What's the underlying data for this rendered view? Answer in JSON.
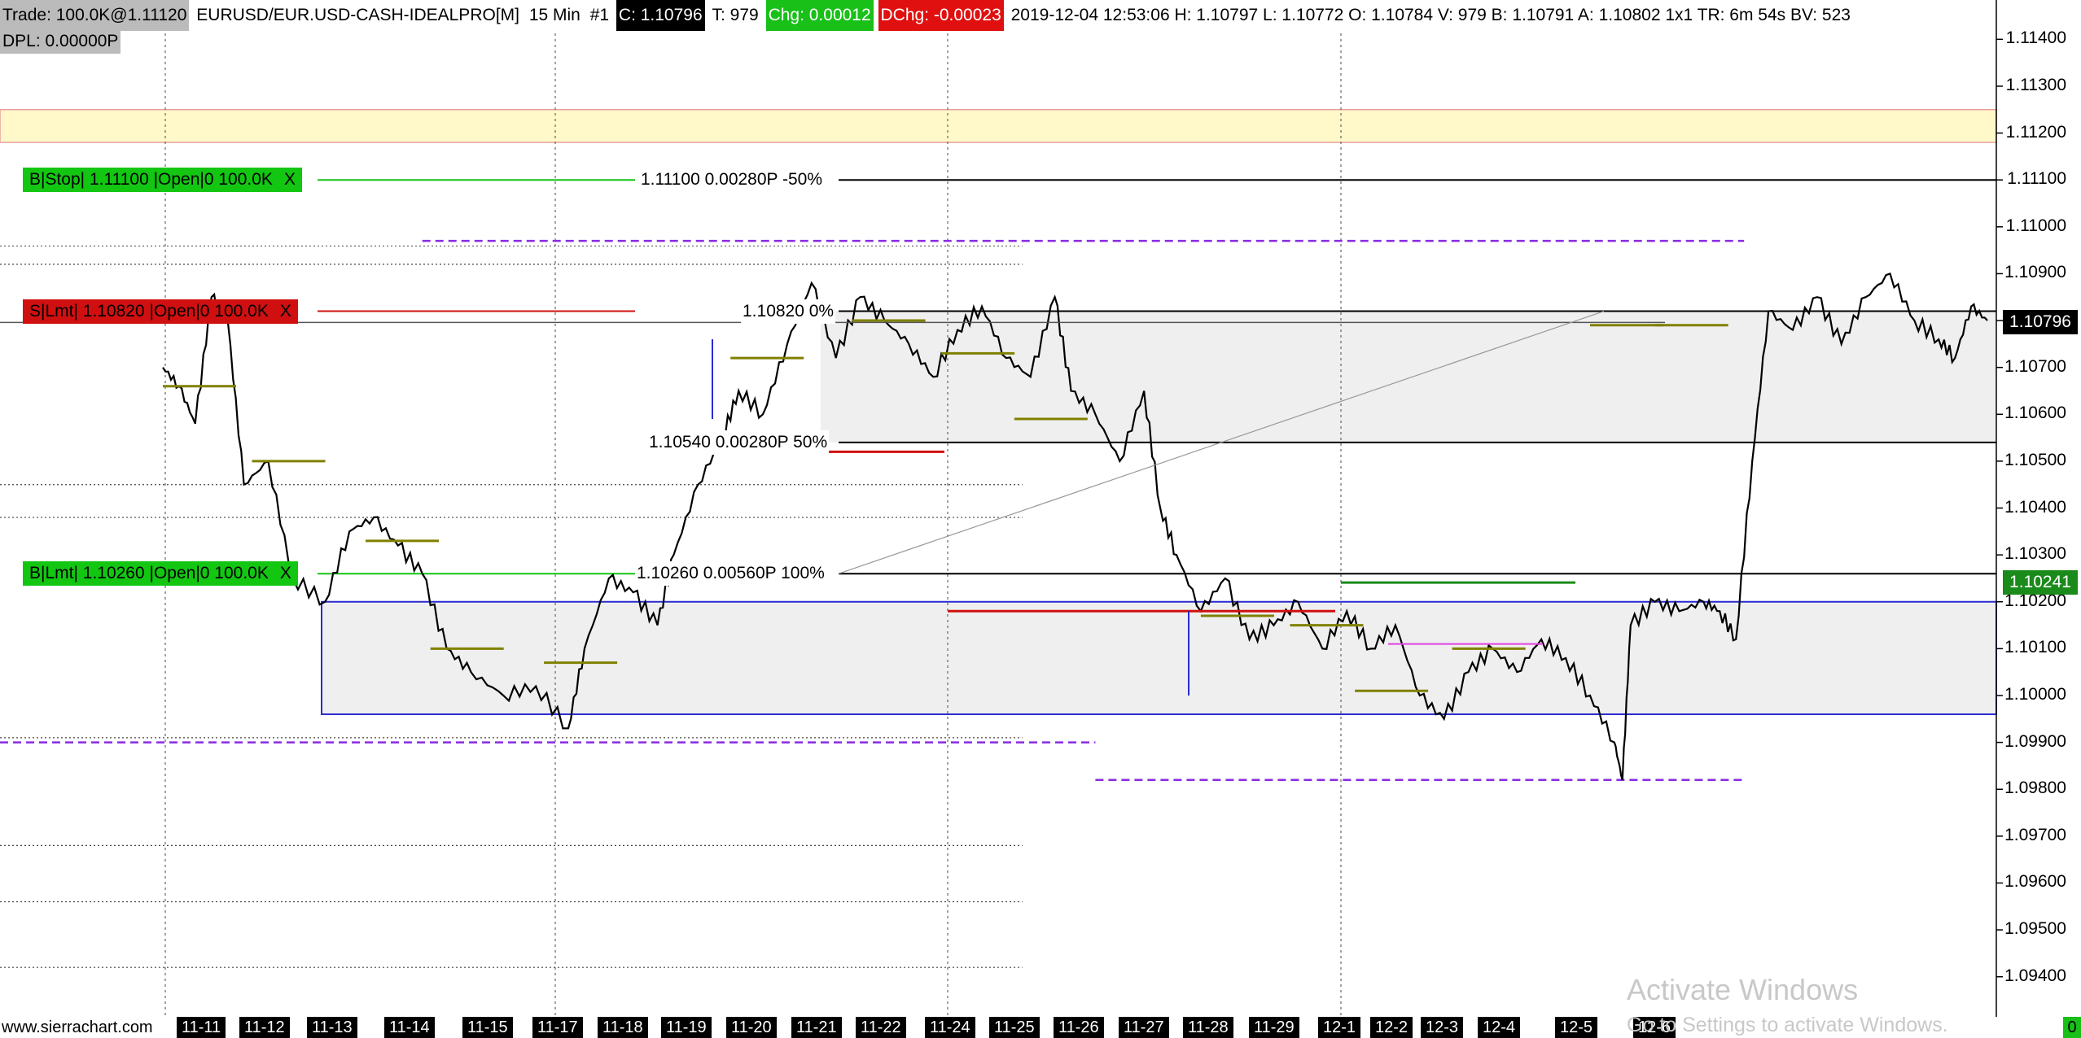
{
  "header": {
    "trade": "Trade: 100.0K@1.11120",
    "symbol": "EURUSD/EUR.USD-CASH-IDEALPRO[M]",
    "interval": "15 Min",
    "chart_num": "#1",
    "close": "C: 1.10796",
    "ticks": "T: 979",
    "chg": "Chg: 0.00012",
    "dchg": "DChg: -0.00023",
    "stats": "2019-12-04 12:53:06 H: 1.10797 L: 1.10772 O: 1.10784 V: 979 B: 1.10791 A: 1.10802 1x1 TR: 6m 54s BV: 523",
    "dpl": "DPL: 0.00000P"
  },
  "orders": [
    {
      "text": "B|Stop| 1.11100 |Open|0  100.0K",
      "close": "X",
      "color": "#12c612",
      "price": 1.111
    },
    {
      "text": "S|Lmt| 1.10820 |Open|0  100.0K",
      "close": "X",
      "color": "#d01010",
      "price": 1.1082
    },
    {
      "text": "B|Lmt| 1.10260 |Open|0  100.0K",
      "close": "X",
      "color": "#12c612",
      "price": 1.1026
    }
  ],
  "fib_labels": [
    {
      "text": "1.11100 0.00280P -50%",
      "price": 1.111
    },
    {
      "text": "1.10820 0%",
      "price": 1.1082
    },
    {
      "text": "1.10540 0.00280P 50%",
      "price": 1.1054
    },
    {
      "text": "1.10260 0.00560P 100%",
      "price": 1.1026
    }
  ],
  "price_tags": [
    {
      "text": "1.10796",
      "price": 1.10796,
      "bg": "#000000"
    },
    {
      "text": "1.10241",
      "price": 1.10241,
      "bg": "#1a8a1a"
    }
  ],
  "footer": {
    "website": "www.sierrachart.com",
    "activate_title": "Activate Windows",
    "activate_sub": "Go to Settings to activate Windows.",
    "corner_badge": "0"
  },
  "colors": {
    "zone_yellow": "#fff8c8",
    "zone_gray": "#efefef",
    "dashed_purple": "#8a2be2",
    "up_line": "#12c612",
    "down_line": "#d01010"
  },
  "chart_data": {
    "type": "candlestick",
    "title": "",
    "xlabel": "",
    "ylabel": "",
    "ylim": [
      1.0937,
      1.1147
    ],
    "yticks": [
      "1.11400",
      "1.11300",
      "1.11200",
      "1.11100",
      "1.11000",
      "1.10900",
      "1.10800",
      "1.10700",
      "1.10600",
      "1.10500",
      "1.10400",
      "1.10300",
      "1.10200",
      "1.10100",
      "1.10000",
      "1.09900",
      "1.09800",
      "1.09700",
      "1.09600",
      "1.09500",
      "1.09400"
    ],
    "xticks": [
      "11-11",
      "11-12",
      "11-13",
      "11-14",
      "11-15",
      "11-17",
      "11-18",
      "11-19",
      "11-20",
      "11-21",
      "11-22",
      "11-24",
      "11-25",
      "11-26",
      "11-27",
      "11-28",
      "11-29",
      "12-1",
      "12-2",
      "12-3",
      "12-4",
      "12-5",
      "12-6"
    ],
    "price_path": [
      [
        0,
        1.107
      ],
      [
        0.2,
        1.1066
      ],
      [
        0.4,
        1.1058
      ],
      [
        0.6,
        1.1085
      ],
      [
        0.8,
        1.108
      ],
      [
        1.0,
        1.1045
      ],
      [
        1.3,
        1.105
      ],
      [
        1.6,
        1.1025
      ],
      [
        2.0,
        1.102
      ],
      [
        2.3,
        1.1035
      ],
      [
        2.6,
        1.1038
      ],
      [
        2.9,
        1.1032
      ],
      [
        3.2,
        1.1026
      ],
      [
        3.5,
        1.101
      ],
      [
        3.8,
        1.1005
      ],
      [
        4.2,
        1.1
      ],
      [
        4.6,
        1.1002
      ],
      [
        5.0,
        1.0993
      ],
      [
        5.2,
        1.101
      ],
      [
        5.5,
        1.1025
      ],
      [
        5.8,
        1.1022
      ],
      [
        6.1,
        1.1015
      ],
      [
        6.3,
        1.103
      ],
      [
        6.6,
        1.1045
      ],
      [
        6.9,
        1.1055
      ],
      [
        7.1,
        1.1065
      ],
      [
        7.4,
        1.106
      ],
      [
        7.7,
        1.1075
      ],
      [
        8.0,
        1.1088
      ],
      [
        8.3,
        1.1072
      ],
      [
        8.6,
        1.1085
      ],
      [
        8.9,
        1.108
      ],
      [
        9.2,
        1.1075
      ],
      [
        9.5,
        1.1068
      ],
      [
        9.8,
        1.1078
      ],
      [
        10.1,
        1.1083
      ],
      [
        10.4,
        1.1072
      ],
      [
        10.7,
        1.1068
      ],
      [
        11.0,
        1.1085
      ],
      [
        11.2,
        1.1065
      ],
      [
        11.5,
        1.106
      ],
      [
        11.8,
        1.105
      ],
      [
        12.1,
        1.1065
      ],
      [
        12.3,
        1.104
      ],
      [
        12.5,
        1.103
      ],
      [
        12.8,
        1.1018
      ],
      [
        13.1,
        1.1025
      ],
      [
        13.4,
        1.1012
      ],
      [
        13.7,
        1.1015
      ],
      [
        14.0,
        1.102
      ],
      [
        14.3,
        1.101
      ],
      [
        14.6,
        1.1018
      ],
      [
        14.9,
        1.101
      ],
      [
        15.2,
        1.1015
      ],
      [
        15.5,
        1.1
      ],
      [
        15.8,
        1.0995
      ],
      [
        16.1,
        1.1005
      ],
      [
        16.4,
        1.101
      ],
      [
        16.7,
        1.1005
      ],
      [
        17.0,
        1.1012
      ],
      [
        17.3,
        1.1008
      ],
      [
        17.6,
        1.1
      ],
      [
        17.9,
        1.099
      ],
      [
        18.0,
        1.0982
      ],
      [
        18.1,
        1.1015
      ],
      [
        18.4,
        1.102
      ],
      [
        18.7,
        1.1018
      ],
      [
        19.0,
        1.102
      ],
      [
        19.2,
        1.1018
      ],
      [
        19.4,
        1.1012
      ],
      [
        19.6,
        1.105
      ],
      [
        19.8,
        1.1082
      ],
      [
        20.1,
        1.1078
      ],
      [
        20.4,
        1.1085
      ],
      [
        20.7,
        1.1075
      ],
      [
        21.0,
        1.1085
      ],
      [
        21.3,
        1.109
      ],
      [
        21.6,
        1.108
      ],
      [
        21.9,
        1.1076
      ],
      [
        22.1,
        1.1072
      ],
      [
        22.3,
        1.1083
      ],
      [
        22.5,
        1.108
      ]
    ]
  }
}
